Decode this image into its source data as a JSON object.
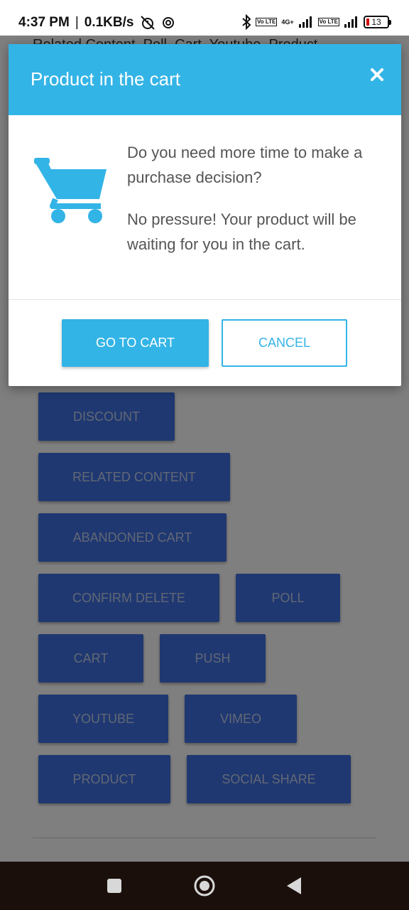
{
  "status_bar": {
    "time": "4:37 PM",
    "separator": "|",
    "speed": "0.1KB/s",
    "network_tag": "4G+",
    "volte_tag_1": "Vo LTE",
    "volte_tag_2": "Vo LTE",
    "battery": "13"
  },
  "page": {
    "top_text": "Related Content, Poll, Cart, Youtube, Product",
    "buttons": [
      [
        "DISCOUNT"
      ],
      [
        "RELATED CONTENT"
      ],
      [
        "ABANDONED CART"
      ],
      [
        "CONFIRM DELETE",
        "POLL"
      ],
      [
        "CART",
        "PUSH"
      ],
      [
        "YOUTUBE",
        "VIMEO"
      ],
      [
        "PRODUCT",
        "SOCIAL SHARE"
      ]
    ]
  },
  "dialog": {
    "title": "Product in the cart",
    "message_1": "Do you need more time to make a purchase decision?",
    "message_2": "No pressure! Your product will be waiting for you in the cart.",
    "primary_button": "GO TO CART",
    "cancel_button": "CANCEL"
  },
  "colors": {
    "accent": "#33b4e6",
    "demo_button": "#3f71e3",
    "nav_bar": "#1a0f0b"
  },
  "icons": {
    "close": "close-icon",
    "cart": "shopping-cart-icon",
    "nav_recent": "square-icon",
    "nav_home": "circle-icon",
    "nav_back": "triangle-back-icon"
  }
}
